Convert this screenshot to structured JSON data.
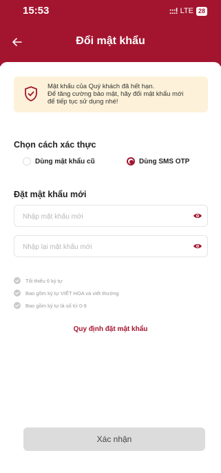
{
  "status_bar": {
    "time": "15:53",
    "signal": ":::!",
    "network": "LTE",
    "battery": "28"
  },
  "nav": {
    "title": "Đổi mật khẩu"
  },
  "notice": {
    "line1": "Mật khẩu của Quý khách đã hết hạn.",
    "line2": "Để tăng cường bảo mật, hãy đổi mật khẩu mới",
    "line3": "để tiếp tục sử dụng nhé!"
  },
  "auth": {
    "title": "Chọn cách xác thực",
    "options": [
      {
        "label": "Dùng mật khẩu cũ",
        "selected": false
      },
      {
        "label": "Dùng SMS OTP",
        "selected": true
      }
    ]
  },
  "new_password": {
    "title": "Đặt mật khẩu mới",
    "new_placeholder": "Nhập mật khẩu mới",
    "new_value": "",
    "confirm_placeholder": "Nhập lại mật khẩu mới",
    "confirm_value": ""
  },
  "rules": [
    "Tối thiểu 6 ký tự",
    "Bao gồm ký tự VIẾT HOA và viết thường",
    "Bao gồm ký tự là số từ 0-9"
  ],
  "policy_link": "Quy định đặt mật khẩu",
  "confirm_button": "Xác nhận",
  "colors": {
    "brand": "#a3152f",
    "notice_bg": "#fdf2d9",
    "button_disabled": "#dcdcdc"
  }
}
